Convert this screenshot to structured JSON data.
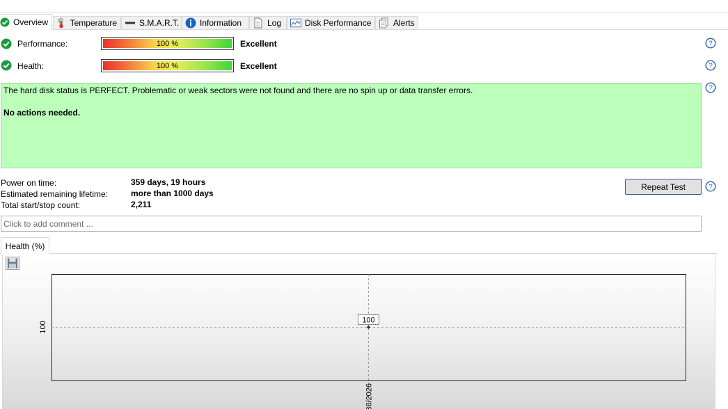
{
  "tabs": [
    {
      "label": "Overview",
      "icon": "check-circle-icon",
      "active": true
    },
    {
      "label": "Temperature",
      "icon": "thermometer-icon",
      "active": false
    },
    {
      "label": "S.M.A.R.T.",
      "icon": "smart-bar-icon",
      "active": false
    },
    {
      "label": "Information",
      "icon": "info-icon",
      "active": false
    },
    {
      "label": "Log",
      "icon": "document-icon",
      "active": false
    },
    {
      "label": "Disk Performance",
      "icon": "performance-chart-icon",
      "active": false
    },
    {
      "label": "Alerts",
      "icon": "alerts-icon",
      "active": false
    }
  ],
  "performance": {
    "label": "Performance:",
    "value_text": "100 %",
    "percent": 100,
    "rating": "Excellent"
  },
  "health": {
    "label": "Health:",
    "value_text": "100 %",
    "percent": 100,
    "rating": "Excellent"
  },
  "status": {
    "message": "The hard disk status is PERFECT. Problematic or weak sectors were not found and there are no spin up or data transfer errors.",
    "action": "No actions needed."
  },
  "info": {
    "power_on_label": "Power on time:",
    "power_on_value": "359 days, 19 hours",
    "lifetime_label": "Estimated remaining lifetime:",
    "lifetime_value": "more than 1000 days",
    "startstop_label": "Total start/stop count:",
    "startstop_value": "2,211"
  },
  "repeat_button": "Repeat Test",
  "comment": {
    "placeholder": "Click to add comment ...",
    "value": ""
  },
  "chart_tab": "Health (%)",
  "chart_data": {
    "type": "line",
    "title": "",
    "xlabel": "",
    "ylabel": "",
    "x": [
      "30/2026"
    ],
    "series": [
      {
        "values": [
          100
        ]
      }
    ],
    "y_tick_labels": [
      "100"
    ],
    "x_tick_labels": [
      "30/2026"
    ],
    "data_labels": [
      "100"
    ],
    "grid": true
  },
  "colors": {
    "status_bg": "#bbffbb",
    "check_green": "#1a9c3e",
    "help_blue": "#2d5fa8"
  }
}
